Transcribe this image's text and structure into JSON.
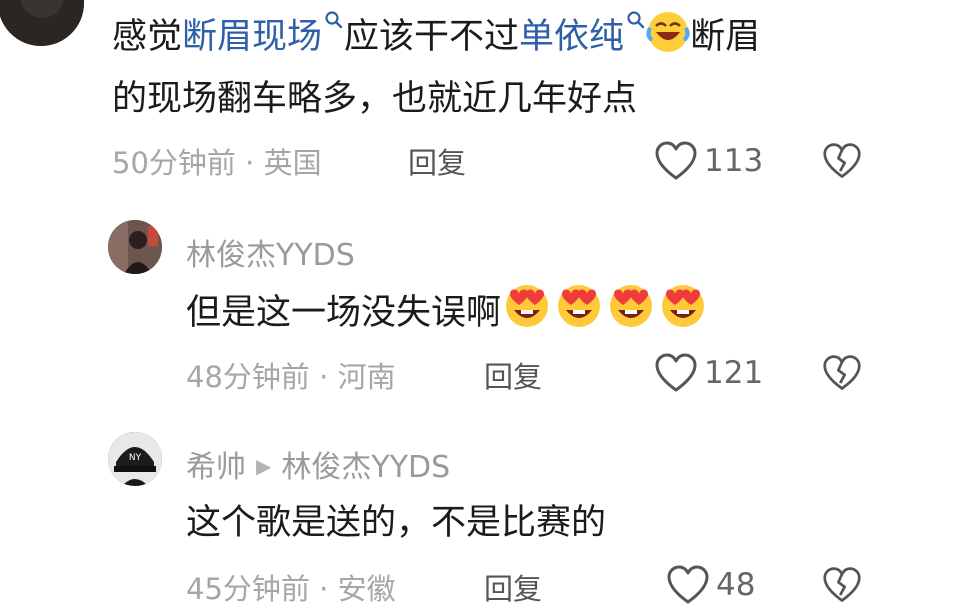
{
  "comments": [
    {
      "line1": {
        "pre": "感觉",
        "link1": "断眉现场",
        "mid": "应该干不过",
        "link2": "单依纯",
        "post": "断眉"
      },
      "line2": "的现场翻车略多，也就近几年好点",
      "time": "50分钟前",
      "location": "英国",
      "reply_label": "回复",
      "likes": "113"
    },
    {
      "nickname": "林俊杰YYDS",
      "text": "但是这一场没失误啊",
      "time": "48分钟前",
      "location": "河南",
      "reply_label": "回复",
      "likes": "121"
    },
    {
      "nickname": "希帅",
      "reply_to": "林俊杰YYDS",
      "text": "这个歌是送的，不是比赛的",
      "time": "45分钟前",
      "location": "安徽",
      "reply_label": "回复",
      "likes": "48"
    }
  ],
  "separator": "·",
  "icons": {
    "like": "heart-outline-icon",
    "dislike": "broken-heart-icon",
    "search": "search-icon",
    "reply_arrow": "triangle-right-icon",
    "emoji_laugh": "laughing-crying-emoji",
    "emoji_heart_eyes": "heart-eyes-emoji"
  },
  "colors": {
    "link": "#2f5fa8",
    "meta": "#a6a6a6",
    "nickname": "#9a9a9a",
    "text": "#1b1b1b"
  }
}
